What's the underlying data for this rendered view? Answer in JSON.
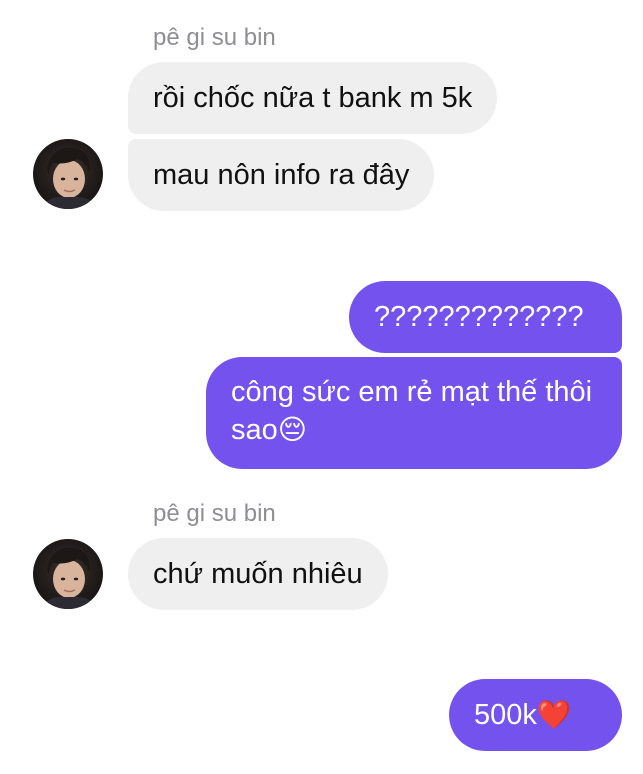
{
  "messages": {
    "m1": {
      "sender": "pê gi su bin",
      "text": "rồi chốc nữa t bank m 5k"
    },
    "m2": {
      "text": "mau nôn info ra đây"
    },
    "m3": {
      "text": "?????????????"
    },
    "m4": {
      "text": "công sức em rẻ mạt thế thôi sao",
      "emoji": "😔"
    },
    "m5": {
      "sender": "pê gi su bin",
      "text": "chứ muốn nhiêu"
    },
    "m6": {
      "text": "500k",
      "emoji": "❤️"
    }
  },
  "avatar": {
    "icon": "user-avatar-photo"
  },
  "colors": {
    "incoming_bubble": "#efefef",
    "outgoing_bubble": "#7452ee",
    "sender_name": "#8e8e93"
  }
}
